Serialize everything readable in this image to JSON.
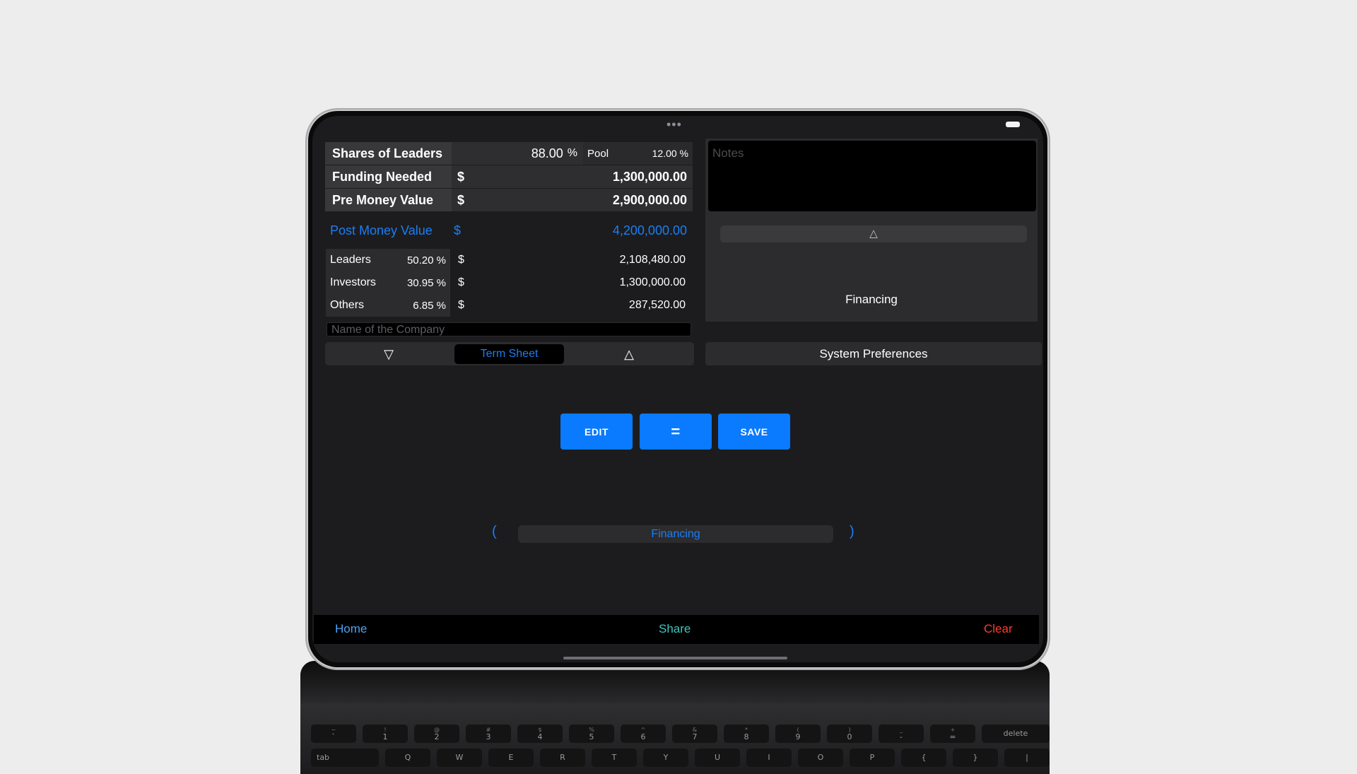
{
  "keyboard": {
    "row1": [
      {
        "top": "~",
        "main": "`"
      },
      {
        "top": "!",
        "main": "1"
      },
      {
        "top": "@",
        "main": "2"
      },
      {
        "top": "#",
        "main": "3"
      },
      {
        "top": "$",
        "main": "4"
      },
      {
        "top": "%",
        "main": "5"
      },
      {
        "top": "^",
        "main": "6"
      },
      {
        "top": "&",
        "main": "7"
      },
      {
        "top": "*",
        "main": "8"
      },
      {
        "top": "(",
        "main": "9"
      },
      {
        "top": ")",
        "main": "0"
      },
      {
        "top": "_",
        "main": "-"
      },
      {
        "top": "+",
        "main": "="
      }
    ],
    "delete_label": "delete",
    "tab_label": "tab",
    "row2": [
      "Q",
      "W",
      "E",
      "R",
      "T",
      "Y",
      "U",
      "I",
      "O",
      "P",
      "{",
      "}",
      "|"
    ]
  },
  "status": {
    "dots": "•••"
  },
  "summary": {
    "shares": {
      "label": "Shares of Leaders",
      "percent": "88.00",
      "percent_sign": "%",
      "pool_label": "Pool",
      "pool_value": "12.00 %"
    },
    "funding": {
      "label": "Funding Needed",
      "currency": "$",
      "value": "1,300,000.00"
    },
    "pre_money": {
      "label": "Pre Money Value",
      "currency": "$",
      "value": "2,900,000.00"
    },
    "post_money": {
      "label": "Post Money Value",
      "currency": "$",
      "value": "4,200,000.00"
    }
  },
  "breakdown": [
    {
      "label": "Leaders",
      "percent": "50.20 %",
      "currency": "$",
      "value": "2,108,480.00"
    },
    {
      "label": "Investors",
      "percent": "30.95 %",
      "currency": "$",
      "value": "1,300,000.00"
    },
    {
      "label": "Others",
      "percent": "6.85 %",
      "currency": "$",
      "value": "287,520.00"
    }
  ],
  "company_placeholder": "Name of the Company",
  "notes_placeholder": "Notes",
  "right_panel": {
    "up_arrow": "△",
    "title": "Financing"
  },
  "segment": {
    "down": "▽",
    "term_sheet": "Term Sheet",
    "up": "△"
  },
  "system_prefs": "System Preferences",
  "actions": {
    "edit": "EDIT",
    "equals": "=",
    "save": "SAVE"
  },
  "pager": {
    "prev": "(",
    "label": "Financing",
    "next": ")"
  },
  "bottom": {
    "home": "Home",
    "share": "Share",
    "clear": "Clear"
  },
  "colors": {
    "accent": "#0a7aff",
    "home": "#4aa3f0",
    "share": "#3ec6c0",
    "clear": "#ff3b30"
  }
}
